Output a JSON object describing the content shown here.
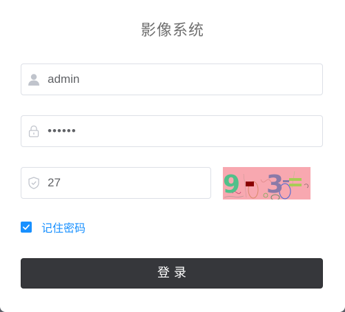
{
  "title": "影像系统",
  "username": {
    "value": "admin",
    "icon": "user-icon"
  },
  "password": {
    "value": "123456",
    "icon": "lock-icon"
  },
  "code": {
    "value": "27",
    "icon": "shield-icon"
  },
  "captcha": {
    "text": "9 - 3 =",
    "background": "#f8a8b0",
    "digit_colors": [
      "#52c08a",
      "#8a7aa8"
    ]
  },
  "remember": {
    "label": "记住密码",
    "checked": true,
    "color": "#1890ff"
  },
  "login_button": {
    "label": "登录",
    "background": "#36373b"
  }
}
